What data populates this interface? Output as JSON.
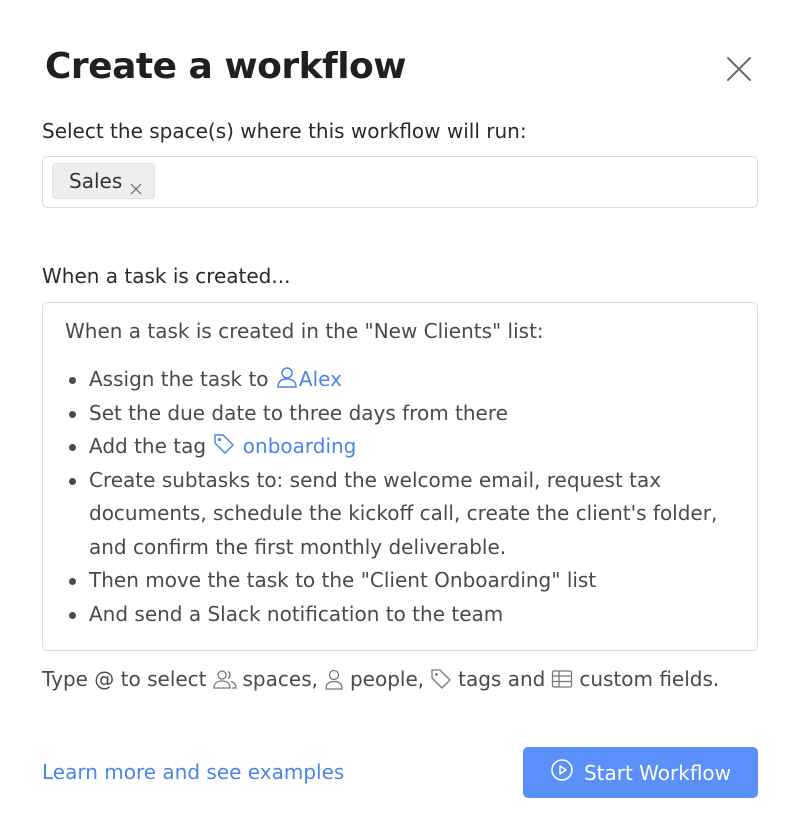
{
  "dialog": {
    "title": "Create a workflow",
    "close_icon": "close-icon"
  },
  "spaces": {
    "label": "Select the space(s) where this workflow will run:",
    "selected": [
      {
        "label": "Sales",
        "remove_glyph": "x"
      }
    ]
  },
  "trigger": {
    "label": "When a task is created...",
    "intro": "When a task is created in the \"New Clients\" list:",
    "items": [
      {
        "text": "Assign the task to",
        "mention": "Alex",
        "mention_icon": "person-icon"
      },
      {
        "text": "Set the due date to three days from there"
      },
      {
        "text": "Add the tag",
        "mention": "onboarding",
        "mention_icon": "tag-icon"
      },
      {
        "text": "Create subtasks to: send the welcome email, request tax documents, schedule the kickoff call, create the client's folder, and confirm the first monthly deliverable."
      },
      {
        "text": "Then move the task to the \"Client Onboarding\" list"
      },
      {
        "text": "And send a Slack notification to the team"
      }
    ]
  },
  "hint": {
    "prefix": "Type @ to select",
    "spaces": "spaces,",
    "people": "people,",
    "tags": "tags and",
    "custom_fields": "custom fields."
  },
  "footer": {
    "learn_more": "Learn more and see examples",
    "start_button": "Start Workflow",
    "start_icon": "play-circle-icon"
  },
  "colors": {
    "accent": "#5b8ff9",
    "link": "#4a86e8",
    "border": "#dcdcdc"
  }
}
